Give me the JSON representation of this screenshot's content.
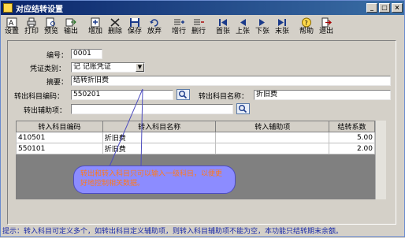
{
  "window": {
    "title": "对应结转设置"
  },
  "toolbar": [
    {
      "name": "settings",
      "label": "设置",
      "icon": "settings-icon"
    },
    {
      "name": "print",
      "label": "打印",
      "icon": "printer-icon"
    },
    {
      "name": "preview",
      "label": "预览",
      "icon": "preview-icon"
    },
    {
      "name": "export",
      "label": "输出",
      "icon": "export-icon"
    },
    {
      "name": "add",
      "label": "增加",
      "icon": "add-icon"
    },
    {
      "name": "delete",
      "label": "删除",
      "icon": "delete-icon"
    },
    {
      "name": "save",
      "label": "保存",
      "icon": "save-icon"
    },
    {
      "name": "cancel",
      "label": "放弃",
      "icon": "undo-icon"
    },
    {
      "name": "add-row",
      "label": "增行",
      "icon": "add-row-icon"
    },
    {
      "name": "delete-row",
      "label": "删行",
      "icon": "delete-row-icon"
    },
    {
      "name": "first",
      "label": "首张",
      "icon": "first-icon"
    },
    {
      "name": "prev",
      "label": "上张",
      "icon": "prev-icon"
    },
    {
      "name": "next",
      "label": "下张",
      "icon": "next-icon"
    },
    {
      "name": "last",
      "label": "末张",
      "icon": "last-icon"
    },
    {
      "name": "help",
      "label": "帮助",
      "icon": "help-icon"
    },
    {
      "name": "exit",
      "label": "退出",
      "icon": "exit-icon"
    }
  ],
  "form": {
    "number_label": "编号：",
    "number_value": "0001",
    "voucher_type_label": "凭证类别：",
    "voucher_type_value": "记 记账凭证",
    "summary_label": "摘要：",
    "summary_value": "结转折旧费",
    "out_code_label": "转出科目编码：",
    "out_code_value": "550201",
    "out_name_label": "转出科目名称：",
    "out_name_value": "折旧费",
    "out_aux_label": "转出辅助项：",
    "out_aux_value": ""
  },
  "grid": {
    "columns": [
      "转入科目编码",
      "转入科目名称",
      "转入辅助项",
      "结转系数"
    ],
    "rows": [
      [
        "410501",
        "折旧费",
        "",
        "5.00"
      ],
      [
        "550101",
        "折旧费",
        "",
        "2.00"
      ]
    ]
  },
  "callout": {
    "text": "转出和转入科目只可以输入一级科目，以便更好地控制相关数据。"
  },
  "statusbar": {
    "text": "提示：转入科目可定义多个，如转出科目定义辅助项，则转入科目辅助项不能为空，本功能只结转期末余额。"
  }
}
